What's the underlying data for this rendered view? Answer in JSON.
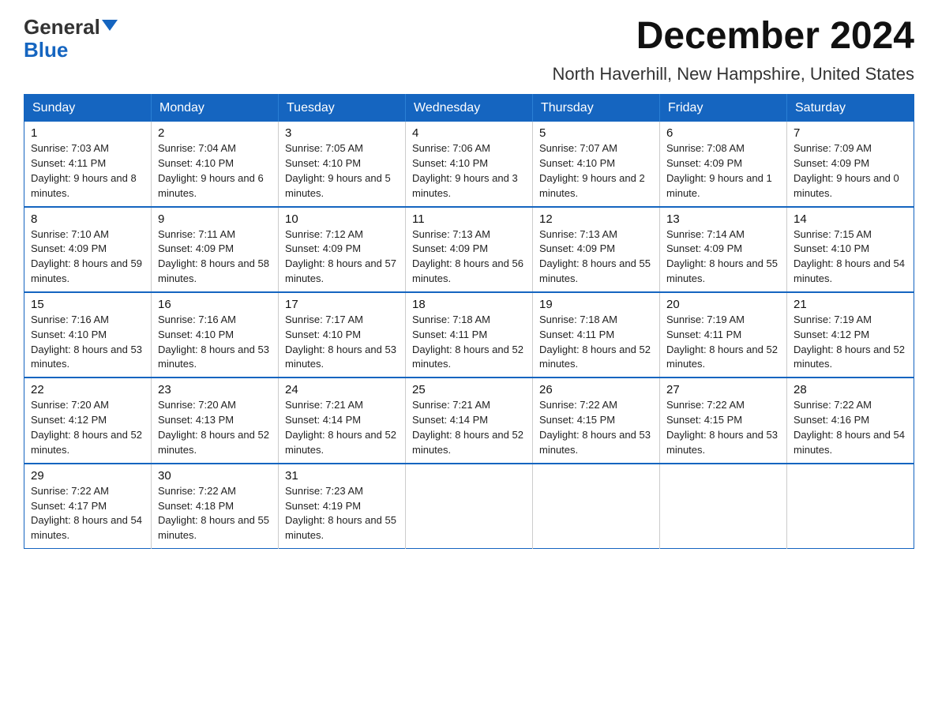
{
  "header": {
    "logo_general": "General",
    "logo_blue": "Blue",
    "month_title": "December 2024",
    "location": "North Haverhill, New Hampshire, United States"
  },
  "weekdays": [
    "Sunday",
    "Monday",
    "Tuesday",
    "Wednesday",
    "Thursday",
    "Friday",
    "Saturday"
  ],
  "weeks": [
    [
      {
        "day": "1",
        "sunrise": "7:03 AM",
        "sunset": "4:11 PM",
        "daylight": "9 hours and 8 minutes."
      },
      {
        "day": "2",
        "sunrise": "7:04 AM",
        "sunset": "4:10 PM",
        "daylight": "9 hours and 6 minutes."
      },
      {
        "day": "3",
        "sunrise": "7:05 AM",
        "sunset": "4:10 PM",
        "daylight": "9 hours and 5 minutes."
      },
      {
        "day": "4",
        "sunrise": "7:06 AM",
        "sunset": "4:10 PM",
        "daylight": "9 hours and 3 minutes."
      },
      {
        "day": "5",
        "sunrise": "7:07 AM",
        "sunset": "4:10 PM",
        "daylight": "9 hours and 2 minutes."
      },
      {
        "day": "6",
        "sunrise": "7:08 AM",
        "sunset": "4:09 PM",
        "daylight": "9 hours and 1 minute."
      },
      {
        "day": "7",
        "sunrise": "7:09 AM",
        "sunset": "4:09 PM",
        "daylight": "9 hours and 0 minutes."
      }
    ],
    [
      {
        "day": "8",
        "sunrise": "7:10 AM",
        "sunset": "4:09 PM",
        "daylight": "8 hours and 59 minutes."
      },
      {
        "day": "9",
        "sunrise": "7:11 AM",
        "sunset": "4:09 PM",
        "daylight": "8 hours and 58 minutes."
      },
      {
        "day": "10",
        "sunrise": "7:12 AM",
        "sunset": "4:09 PM",
        "daylight": "8 hours and 57 minutes."
      },
      {
        "day": "11",
        "sunrise": "7:13 AM",
        "sunset": "4:09 PM",
        "daylight": "8 hours and 56 minutes."
      },
      {
        "day": "12",
        "sunrise": "7:13 AM",
        "sunset": "4:09 PM",
        "daylight": "8 hours and 55 minutes."
      },
      {
        "day": "13",
        "sunrise": "7:14 AM",
        "sunset": "4:09 PM",
        "daylight": "8 hours and 55 minutes."
      },
      {
        "day": "14",
        "sunrise": "7:15 AM",
        "sunset": "4:10 PM",
        "daylight": "8 hours and 54 minutes."
      }
    ],
    [
      {
        "day": "15",
        "sunrise": "7:16 AM",
        "sunset": "4:10 PM",
        "daylight": "8 hours and 53 minutes."
      },
      {
        "day": "16",
        "sunrise": "7:16 AM",
        "sunset": "4:10 PM",
        "daylight": "8 hours and 53 minutes."
      },
      {
        "day": "17",
        "sunrise": "7:17 AM",
        "sunset": "4:10 PM",
        "daylight": "8 hours and 53 minutes."
      },
      {
        "day": "18",
        "sunrise": "7:18 AM",
        "sunset": "4:11 PM",
        "daylight": "8 hours and 52 minutes."
      },
      {
        "day": "19",
        "sunrise": "7:18 AM",
        "sunset": "4:11 PM",
        "daylight": "8 hours and 52 minutes."
      },
      {
        "day": "20",
        "sunrise": "7:19 AM",
        "sunset": "4:11 PM",
        "daylight": "8 hours and 52 minutes."
      },
      {
        "day": "21",
        "sunrise": "7:19 AM",
        "sunset": "4:12 PM",
        "daylight": "8 hours and 52 minutes."
      }
    ],
    [
      {
        "day": "22",
        "sunrise": "7:20 AM",
        "sunset": "4:12 PM",
        "daylight": "8 hours and 52 minutes."
      },
      {
        "day": "23",
        "sunrise": "7:20 AM",
        "sunset": "4:13 PM",
        "daylight": "8 hours and 52 minutes."
      },
      {
        "day": "24",
        "sunrise": "7:21 AM",
        "sunset": "4:14 PM",
        "daylight": "8 hours and 52 minutes."
      },
      {
        "day": "25",
        "sunrise": "7:21 AM",
        "sunset": "4:14 PM",
        "daylight": "8 hours and 52 minutes."
      },
      {
        "day": "26",
        "sunrise": "7:22 AM",
        "sunset": "4:15 PM",
        "daylight": "8 hours and 53 minutes."
      },
      {
        "day": "27",
        "sunrise": "7:22 AM",
        "sunset": "4:15 PM",
        "daylight": "8 hours and 53 minutes."
      },
      {
        "day": "28",
        "sunrise": "7:22 AM",
        "sunset": "4:16 PM",
        "daylight": "8 hours and 54 minutes."
      }
    ],
    [
      {
        "day": "29",
        "sunrise": "7:22 AM",
        "sunset": "4:17 PM",
        "daylight": "8 hours and 54 minutes."
      },
      {
        "day": "30",
        "sunrise": "7:22 AM",
        "sunset": "4:18 PM",
        "daylight": "8 hours and 55 minutes."
      },
      {
        "day": "31",
        "sunrise": "7:23 AM",
        "sunset": "4:19 PM",
        "daylight": "8 hours and 55 minutes."
      },
      null,
      null,
      null,
      null
    ]
  ]
}
